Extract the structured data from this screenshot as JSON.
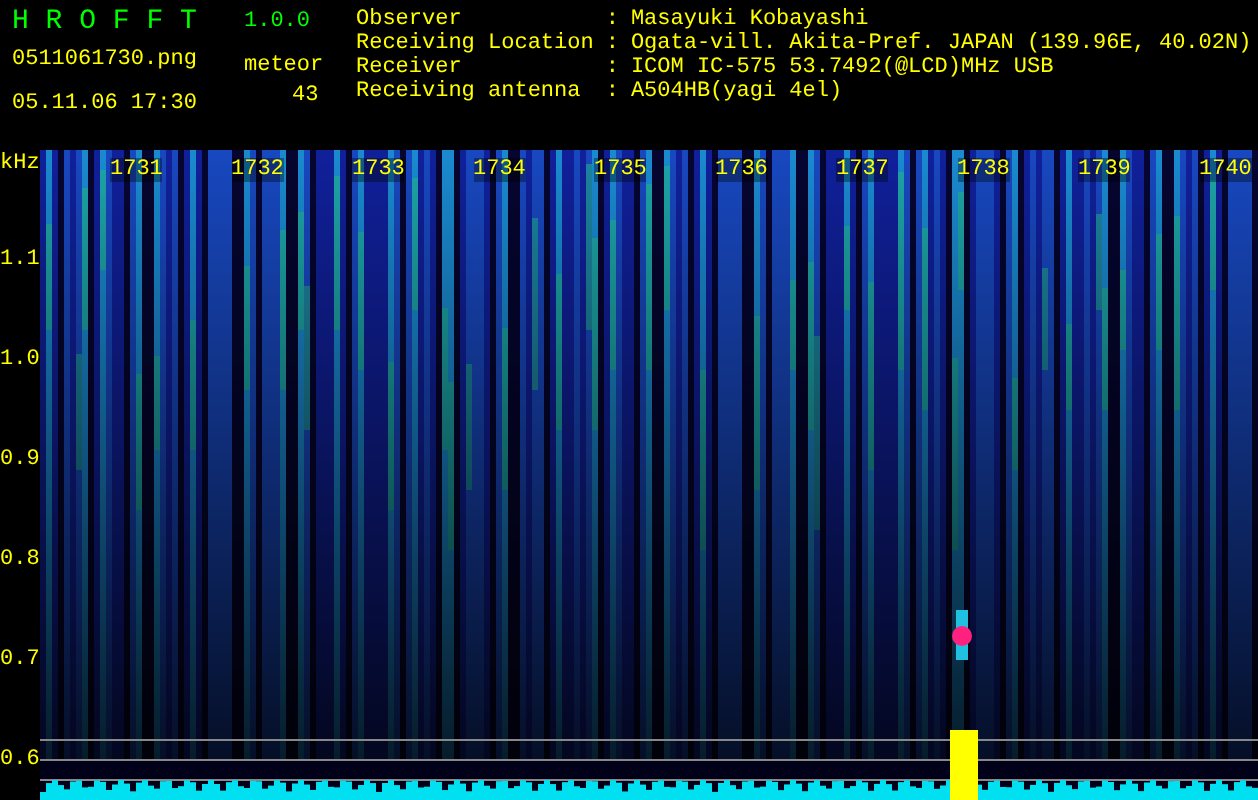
{
  "app": {
    "name": "H R O F F T",
    "version": "1.0.0"
  },
  "file": "0511061730.png",
  "datetime": "05.11.06 17:30",
  "meteor": {
    "label": "meteor",
    "count": "43"
  },
  "info": [
    {
      "label": "Observer",
      "separator": ":",
      "value": "Masayuki Kobayashi"
    },
    {
      "label": "Receiving Location",
      "separator": ":",
      "value": "Ogata-vill. Akita-Pref. JAPAN (139.96E, 40.02N)"
    },
    {
      "label": "Receiver",
      "separator": ":",
      "value": "ICOM IC-575 53.7492(@LCD)MHz USB"
    },
    {
      "label": "Receiving antenna",
      "separator": ":",
      "value": "A504HB(yagi 4el)"
    }
  ],
  "spectrogram": {
    "unit": "kHz",
    "y_labels": [
      "1.1",
      "1.0",
      "0.9",
      "0.8",
      "0.7",
      "0.6"
    ],
    "time_labels": [
      "1731",
      "1732",
      "1733",
      "1734",
      "1735",
      "1736",
      "1737",
      "1738",
      "1739",
      "1740"
    ]
  }
}
